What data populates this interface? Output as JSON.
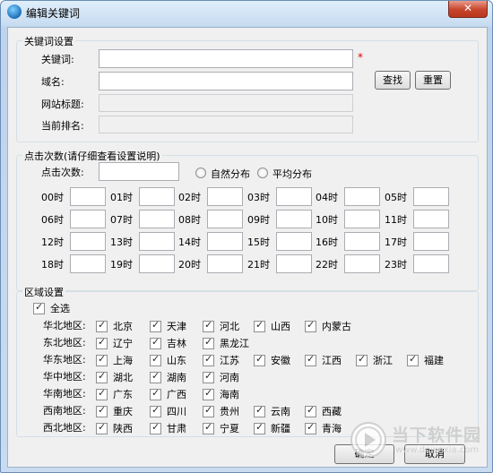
{
  "window": {
    "title": "编辑关键词",
    "close_label": "✕"
  },
  "keyword_group": {
    "title": "关键词设置",
    "keyword_label": "关键词:",
    "domain_label": "域名:",
    "site_title_label": "网站标题:",
    "current_rank_label": "当前排名:",
    "required_mark": "*",
    "find_button": "查找",
    "reset_button": "重置"
  },
  "clicks_group": {
    "title": "点击次数(请仔细查看设置说明)",
    "count_label": "点击次数:",
    "natural_label": "自然分布",
    "average_label": "平均分布",
    "hours": [
      "00时",
      "01时",
      "02时",
      "03时",
      "04时",
      "05时",
      "06时",
      "07时",
      "08时",
      "09时",
      "10时",
      "11时",
      "12时",
      "13时",
      "14时",
      "15时",
      "16时",
      "17时",
      "18时",
      "19时",
      "20时",
      "21时",
      "22时",
      "23时"
    ]
  },
  "region_group": {
    "title": "区域设置",
    "select_all": "全选",
    "regions": [
      {
        "name": "华北地区:",
        "provinces": [
          "北京",
          "天津",
          "河北",
          "山西",
          "内蒙古"
        ]
      },
      {
        "name": "东北地区:",
        "provinces": [
          "辽宁",
          "吉林",
          "黑龙江"
        ]
      },
      {
        "name": "华东地区:",
        "provinces": [
          "上海",
          "山东",
          "江苏",
          "安徽",
          "江西",
          "浙江",
          "福建"
        ]
      },
      {
        "name": "华中地区:",
        "provinces": [
          "湖北",
          "湖南",
          "河南"
        ]
      },
      {
        "name": "华南地区:",
        "provinces": [
          "广东",
          "广西",
          "海南"
        ]
      },
      {
        "name": "西南地区:",
        "provinces": [
          "重庆",
          "四川",
          "贵州",
          "云南",
          "西藏"
        ]
      },
      {
        "name": "西北地区:",
        "provinces": [
          "陕西",
          "甘肃",
          "宁夏",
          "新疆",
          "青海"
        ]
      }
    ]
  },
  "footer": {
    "ok_button": "确定",
    "cancel_button": "取消"
  },
  "watermark": {
    "text": "当下软件园",
    "url": "www.downxia.com"
  }
}
